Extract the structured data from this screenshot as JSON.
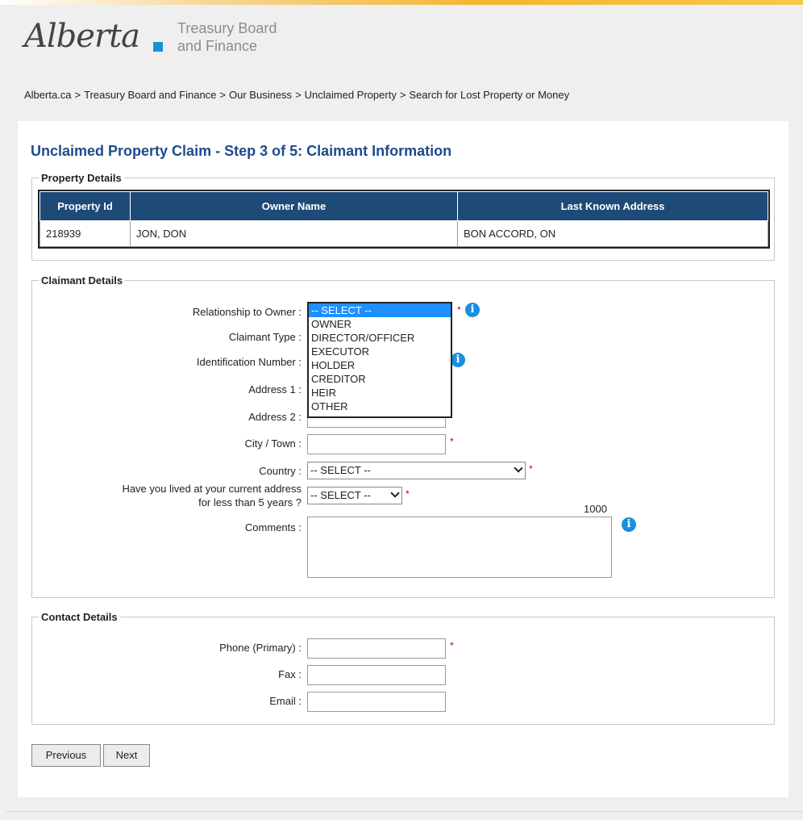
{
  "header": {
    "logo_text": "Alberta",
    "dept_line1": "Treasury Board",
    "dept_line2": "and Finance"
  },
  "breadcrumb": [
    "Alberta.ca",
    "Treasury Board and Finance",
    "Our Business",
    "Unclaimed Property",
    "Search for Lost Property or Money"
  ],
  "breadcrumb_sep": ">",
  "page_title": "Unclaimed Property Claim - Step 3 of 5: Claimant Information",
  "property_details": {
    "legend": "Property Details",
    "columns": [
      "Property Id",
      "Owner Name",
      "Last Known Address"
    ],
    "rows": [
      [
        "218939",
        "JON, DON",
        "BON ACCORD, ON"
      ]
    ]
  },
  "claimant_details": {
    "legend": "Claimant Details",
    "relationship_label": "Relationship to Owner :",
    "relationship_value": "-- SELECT --",
    "relationship_options": [
      "-- SELECT --",
      "OWNER",
      "DIRECTOR/OFFICER",
      "EXECUTOR",
      "HOLDER",
      "CREDITOR",
      "HEIR",
      "OTHER"
    ],
    "claimant_type_label": "Claimant Type :",
    "identification_label": "Identification Number :",
    "address1_label": "Address 1 :",
    "address2_label": "Address 2 :",
    "city_label": "City / Town :",
    "country_label": "Country :",
    "country_value": "-- SELECT --",
    "lived_label_line1": "Have you lived at your current address",
    "lived_label_line2": "for less than 5 years ?",
    "lived_value": "-- SELECT --",
    "comments_label": "Comments :",
    "comments_counter": "1000",
    "required_mark": "*",
    "info_glyph": "i"
  },
  "contact_details": {
    "legend": "Contact Details",
    "phone_label": "Phone (Primary) :",
    "fax_label": "Fax :",
    "email_label": "Email :"
  },
  "buttons": {
    "previous": "Previous",
    "next": "Next"
  },
  "colors": {
    "title": "#1e4a8c",
    "table_header": "#1e4a78",
    "info_icon": "#1a8fe0",
    "required": "#c00000",
    "selected_option": "#1e90ff"
  },
  "icons": {
    "info": "info-circle-icon",
    "chevron": "chevron-down-icon"
  }
}
